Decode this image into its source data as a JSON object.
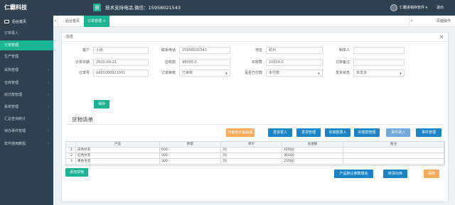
{
  "app": {
    "brand": "仁霸科技"
  },
  "sidebar": {
    "home": "后台首页",
    "items": [
      {
        "label": "订单录入",
        "has_arrow": false
      },
      {
        "label": "订单管理",
        "has_arrow": false,
        "active": true
      },
      {
        "label": "生产管理",
        "has_arrow": false
      },
      {
        "label": "采购管理",
        "has_arrow": true
      },
      {
        "label": "仓库管理",
        "has_arrow": true
      },
      {
        "label": "收付款管理",
        "has_arrow": true
      },
      {
        "label": "系统管理",
        "has_arrow": true
      },
      {
        "label": "汇总查询统计",
        "has_arrow": true
      },
      {
        "label": "待办事件管理",
        "has_arrow": true
      },
      {
        "label": "软件使用教程",
        "has_arrow": true
      }
    ]
  },
  "topbar": {
    "title": "技术支持电话,微信：15958021543",
    "user": "仁霸进销存软件",
    "user_caret": "▾",
    "logout": "退出"
  },
  "tabs": {
    "home": "后台首页",
    "current": "订单管理",
    "current_close": "×",
    "page_ops": "页面操作"
  },
  "dialog": {
    "title": "信息",
    "close": "×"
  },
  "form": {
    "customer_label": "客户",
    "customer_value": "小张",
    "phone_label": "联系电话",
    "phone_value": "15958021543",
    "address_label": "地址",
    "address_value": "杭州",
    "entry_person_label": "制单人",
    "entry_person_value": "",
    "order_date_label": "订单日期",
    "order_date_value": "2020-09-21",
    "receivable_label": "应收款",
    "receivable_value": "98000.0",
    "received_label": "实收款",
    "received_value": "20000.0",
    "remark_label": "订单备注",
    "remark_value": "",
    "order_no_label": "订单号",
    "order_no_value": "dd20200921001",
    "audit_label": "订单审核",
    "audit_value": "已审核",
    "finished_label": "是否已付款",
    "finished_value": "未付款",
    "ship_label": "发货状态",
    "ship_value": "未发货",
    "save_label": "保存"
  },
  "goods": {
    "title": "货物清单",
    "toolbar": [
      {
        "label": "作废到大幅提醒",
        "color": "orange"
      },
      {
        "label": "发货录入",
        "color": "blue"
      },
      {
        "label": "发货管理",
        "color": "blue"
      },
      {
        "label": "实收款录入",
        "color": "blue"
      },
      {
        "label": "实收款管理",
        "color": "blue"
      },
      {
        "label": "事件录入",
        "color": "light"
      },
      {
        "label": "事件管理",
        "color": "blue"
      }
    ],
    "columns": [
      "",
      "产品",
      "数量",
      "单价",
      "总金额",
      "备注"
    ],
    "rows": [
      {
        "no": "1",
        "product": "白色衬衣",
        "qty": "600",
        "price": "70",
        "total": "42000",
        "note": ""
      },
      {
        "no": "2",
        "product": "红色衬衣",
        "qty": "500",
        "price": "70",
        "total": "35000",
        "note": ""
      },
      {
        "no": "3",
        "product": "黄色毛衣",
        "qty": "300",
        "price": "70",
        "total": "21000",
        "note": ""
      }
    ],
    "add_label": "添加货物",
    "bottom_buttons": [
      {
        "label": "产品默认参数填充",
        "color": "blue"
      },
      {
        "label": "转货出库",
        "color": "blue"
      },
      {
        "label": "保存",
        "color": "orange"
      }
    ]
  }
}
